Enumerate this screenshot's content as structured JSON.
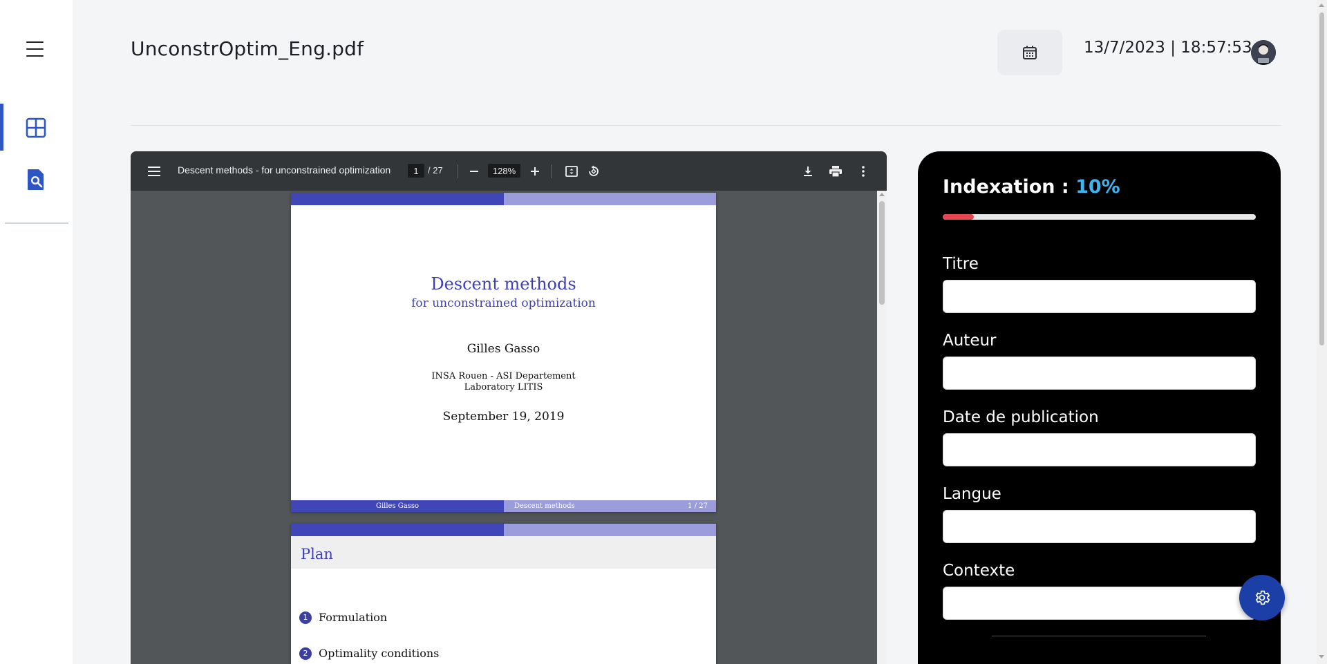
{
  "header": {
    "file_title": "UnconstrOptim_Eng.pdf",
    "datetime": "13/7/2023 | 18:57:53"
  },
  "sidebar": {
    "items": [
      {
        "icon": "dashboard-grid-icon",
        "active": true
      },
      {
        "icon": "document-search-icon",
        "active": false
      }
    ]
  },
  "viewer": {
    "doc_title": "Descent methods - for unconstrained optimization",
    "current_page": "1",
    "page_total": "/ 27",
    "zoom": "128%",
    "slide1": {
      "title": "Descent methods",
      "subtitle": "for unconstrained optimization",
      "author": "Gilles Gasso",
      "institution_line1": "INSA Rouen - ASI Departement",
      "institution_line2": "Laboratory LITIS",
      "date": "September 19, 2019",
      "footer_author": "Gilles Gasso",
      "footer_title": "Descent methods",
      "footer_page": "1 / 27"
    },
    "slide2": {
      "heading": "Plan",
      "items": [
        {
          "num": "1",
          "label": "Formulation"
        },
        {
          "num": "2",
          "label": "Optimality conditions"
        }
      ]
    }
  },
  "panel": {
    "indexation_label": "Indexation : ",
    "indexation_pct": "10%",
    "progress": 0.1,
    "fields": [
      {
        "label": "Titre",
        "value": ""
      },
      {
        "label": "Auteur",
        "value": ""
      },
      {
        "label": "Date de publication",
        "value": ""
      },
      {
        "label": "Langue",
        "value": ""
      },
      {
        "label": "Contexte",
        "value": ""
      }
    ]
  },
  "colors": {
    "accent_blue": "#2e55c4",
    "progress_red": "#ea4550",
    "percent_cyan": "#3fb4ef",
    "fab_blue": "#1b3fa6",
    "beamer_dark": "#4046b8",
    "beamer_light": "#9a9cdc"
  }
}
